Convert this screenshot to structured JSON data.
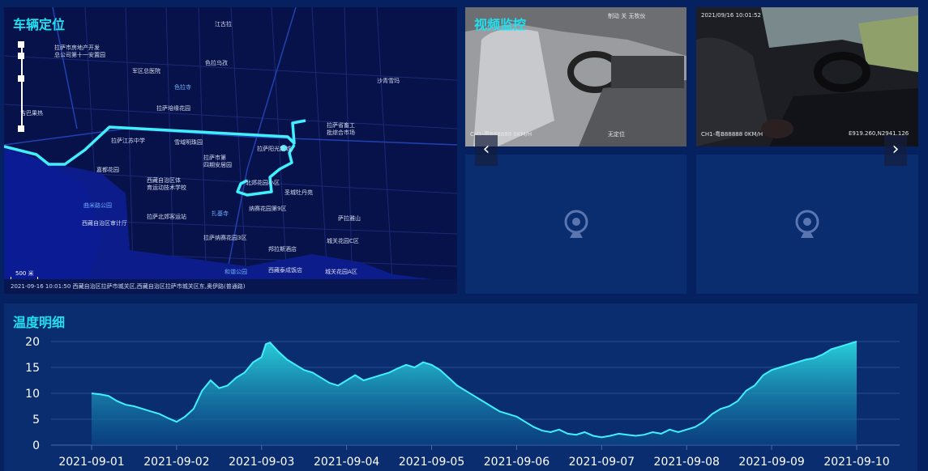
{
  "map": {
    "title": "车辆定位",
    "footer": "2021-09-16 10:01:50 西藏自治区拉萨市城关区,西藏自治区拉萨市城关区东,奥伊路(普通路)",
    "scale_label": "500 米",
    "labels": [
      {
        "text": "江古拉",
        "color": "white"
      },
      {
        "text": "拉萨市房地产开发\n总公司第十一安置园",
        "color": "white"
      },
      {
        "text": "色拉乌孜",
        "color": "white"
      },
      {
        "text": "军区总医院",
        "color": "white"
      },
      {
        "text": "色拉寺",
        "color": "blue"
      },
      {
        "text": "沙青雪玛",
        "color": "white"
      },
      {
        "text": "拉萨培缘花园",
        "color": "white"
      },
      {
        "text": "拉萨省畜工\n批综合市场",
        "color": "white"
      },
      {
        "text": "拉萨江苏中学",
        "color": "white"
      },
      {
        "text": "雪域明珠园",
        "color": "white"
      },
      {
        "text": "拉萨阳光新城",
        "color": "white"
      },
      {
        "text": "拉萨市第\n四期安居园",
        "color": "white"
      },
      {
        "text": "嘉都花园",
        "color": "white"
      },
      {
        "text": "西藏自治区体\n育运动技术学校",
        "color": "white"
      },
      {
        "text": "北郊花园小区",
        "color": "white"
      },
      {
        "text": "圣城牡丹苑",
        "color": "white"
      },
      {
        "text": "曲米路公园",
        "color": "blue"
      },
      {
        "text": "扎基寺",
        "color": "blue"
      },
      {
        "text": "纳赛花园第9区",
        "color": "white"
      },
      {
        "text": "西藏自治区审计厅",
        "color": "white"
      },
      {
        "text": "拉萨北郊客运站",
        "color": "white"
      },
      {
        "text": "萨拉雅山",
        "color": "white"
      },
      {
        "text": "拉萨纳赛花园3区",
        "color": "white"
      },
      {
        "text": "城关花园C区",
        "color": "white"
      },
      {
        "text": "邦拉斯酒店",
        "color": "white"
      },
      {
        "text": "和谐公园",
        "color": "blue"
      },
      {
        "text": "西藏泰成饭店",
        "color": "white"
      },
      {
        "text": "城关花园A区",
        "color": "white"
      },
      {
        "text": "吉巴果热",
        "color": "white"
      }
    ]
  },
  "video": {
    "title": "视频监控",
    "cam1": {
      "top_text": "制动 关 无牧伙",
      "bottom_left": "CH1-粤B88888 0KM/H",
      "bottom_right": "无定位"
    },
    "cam2": {
      "top_text": "2021/09/16 10:01:52",
      "bottom_left": "CH1-粤B88888 0KM/H",
      "bottom_right": "E919.260,N2941.126"
    },
    "prev_arrow": "‹",
    "next_arrow": "›"
  },
  "temperature": {
    "title": "温度明细"
  },
  "chart_data": {
    "type": "area",
    "title": "温度明细",
    "x_ticks": [
      "2021-09-01",
      "2021-09-02",
      "2021-09-03",
      "2021-09-04",
      "2021-09-05",
      "2021-09-06",
      "2021-09-07",
      "2021-09-08",
      "2021-09-09",
      "2021-09-10"
    ],
    "ylim": [
      0,
      20
    ],
    "y_ticks": [
      0,
      5,
      10,
      15,
      20
    ],
    "grid": true,
    "series": [
      {
        "x_day_fraction": [
          0,
          0.1,
          0.2,
          0.3,
          0.4,
          0.5,
          0.6,
          0.7,
          0.8,
          0.9,
          1.0,
          1.1,
          1.2,
          1.3,
          1.4,
          1.5,
          1.6,
          1.7,
          1.8,
          1.9,
          2.0,
          2.05,
          2.1,
          2.2,
          2.3,
          2.4,
          2.5,
          2.6,
          2.7,
          2.8,
          2.9,
          3.0,
          3.1,
          3.2,
          3.3,
          3.4,
          3.5,
          3.6,
          3.7,
          3.8,
          3.9,
          4.0,
          4.1,
          4.2,
          4.3,
          4.4,
          4.5,
          4.6,
          4.7,
          4.8,
          4.9,
          5.0,
          5.1,
          5.2,
          5.3,
          5.4,
          5.5,
          5.6,
          5.7,
          5.8,
          5.9,
          6.0,
          6.1,
          6.2,
          6.3,
          6.4,
          6.5,
          6.6,
          6.7,
          6.8,
          6.9,
          7.0,
          7.1,
          7.2,
          7.3,
          7.4,
          7.5,
          7.6,
          7.7,
          7.8,
          7.9,
          8.0,
          8.1,
          8.2,
          8.3,
          8.4,
          8.5,
          8.6,
          8.7,
          8.8,
          8.9,
          9.0
        ],
        "values": [
          10,
          9.8,
          9.5,
          8.5,
          7.8,
          7.5,
          7.0,
          6.5,
          6.0,
          5.2,
          4.5,
          5.5,
          7.0,
          10.5,
          12.5,
          11.0,
          11.5,
          13.0,
          14.0,
          16.0,
          17.0,
          19.5,
          19.8,
          18.0,
          16.5,
          15.5,
          14.5,
          14.0,
          13.0,
          12.0,
          11.5,
          12.5,
          13.5,
          12.5,
          13.0,
          13.5,
          14.0,
          14.8,
          15.5,
          15.0,
          16.0,
          15.5,
          14.5,
          13.0,
          11.5,
          10.5,
          9.5,
          8.5,
          7.5,
          6.5,
          6.0,
          5.5,
          4.5,
          3.5,
          2.8,
          2.5,
          3.0,
          2.2,
          2.0,
          2.5,
          1.8,
          1.5,
          1.8,
          2.2,
          2.0,
          1.8,
          2.0,
          2.5,
          2.2,
          3.0,
          2.5,
          3.0,
          3.5,
          4.5,
          6.0,
          7.0,
          7.5,
          8.5,
          10.5,
          11.5,
          13.5,
          14.5,
          15.0,
          15.5,
          16.0,
          16.5,
          16.8,
          17.5,
          18.5,
          19.0,
          19.5,
          20.0
        ]
      }
    ]
  }
}
